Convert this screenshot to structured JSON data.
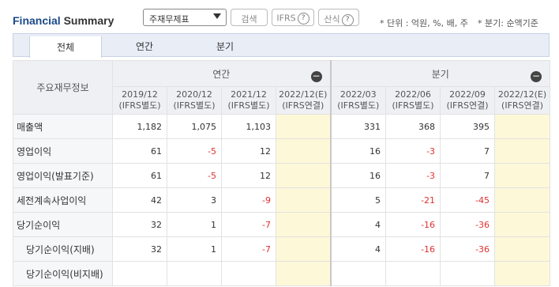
{
  "header": {
    "title_part1": "Financial",
    "title_part2": "Summary",
    "select_value": "주재무제표",
    "search_label": "검색",
    "ifrs_label": "IFRS",
    "calc_label": "산식",
    "unit_note": "* 단위 : 억원, %, 배, 주",
    "quarter_note": "* 분기: 순액기준"
  },
  "tabs": [
    {
      "label": "전체",
      "active": true
    },
    {
      "label": "연간",
      "active": false
    },
    {
      "label": "분기",
      "active": false
    }
  ],
  "table": {
    "row_header": "주요재무정보",
    "annual_group": "연간",
    "quarter_group": "분기",
    "columns": [
      {
        "period": "2019/12",
        "basis": "(IFRS별도)"
      },
      {
        "period": "2020/12",
        "basis": "(IFRS별도)"
      },
      {
        "period": "2021/12",
        "basis": "(IFRS별도)"
      },
      {
        "period": "2022/12(E)",
        "basis": "(IFRS연결)"
      },
      {
        "period": "2022/03",
        "basis": "(IFRS별도)"
      },
      {
        "period": "2022/06",
        "basis": "(IFRS별도)"
      },
      {
        "period": "2022/09",
        "basis": "(IFRS연결)"
      },
      {
        "period": "2022/12(E)",
        "basis": "(IFRS연결)"
      }
    ],
    "rows": [
      {
        "label": "매출액",
        "indent": false,
        "values": [
          "1,182",
          "1,075",
          "1,103",
          "",
          "331",
          "368",
          "395",
          ""
        ]
      },
      {
        "label": "영업이익",
        "indent": false,
        "values": [
          "61",
          "-5",
          "12",
          "",
          "16",
          "-3",
          "7",
          ""
        ]
      },
      {
        "label": "영업이익(발표기준)",
        "indent": false,
        "values": [
          "61",
          "-5",
          "12",
          "",
          "16",
          "-3",
          "7",
          ""
        ]
      },
      {
        "label": "세전계속사업이익",
        "indent": false,
        "values": [
          "42",
          "3",
          "-9",
          "",
          "5",
          "-21",
          "-45",
          ""
        ]
      },
      {
        "label": "당기순이익",
        "indent": false,
        "values": [
          "32",
          "1",
          "-7",
          "",
          "4",
          "-16",
          "-36",
          ""
        ]
      },
      {
        "label": "당기순이익(지배)",
        "indent": true,
        "values": [
          "32",
          "1",
          "-7",
          "",
          "4",
          "-16",
          "-36",
          ""
        ]
      },
      {
        "label": "당기순이익(비지배)",
        "indent": true,
        "values": [
          "",
          "",
          "",
          "",
          "",
          "",
          "",
          ""
        ]
      }
    ]
  },
  "colors": {
    "negative": "#e03131",
    "estimate_bg": "#fdf8d8",
    "tab_bg": "#e8edf6",
    "title_blue": "#1a4a8a"
  }
}
